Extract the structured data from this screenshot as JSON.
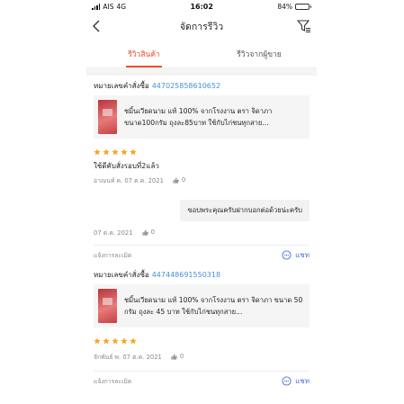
{
  "status": {
    "carrier": "AIS",
    "network": "4G",
    "time": "16:02",
    "battery": "84%",
    "battery_level": 0.84
  },
  "nav": {
    "title": "จัดการรีวิว"
  },
  "tabs": [
    {
      "label": "รีวิวสินค้า",
      "active": true
    },
    {
      "label": "รีวิวจากผู้ขาย",
      "active": false
    }
  ],
  "colors": {
    "accent": "#ee4d2d",
    "link": "#4a8fd6",
    "star": "#f5a623"
  },
  "reviews": [
    {
      "order_label": "หมายเลขคำสั่งซื้อ",
      "order_no": "447025858610652",
      "product": "ชมิ้นเวียดนาม แท้ 100% จากโรงงาน ตรา จิดาภา ขนาด100กรัม ถุงละ85บาท ใช้กับไก่ชนทุกสาย...",
      "rating": 5,
      "text": "ใช้ดีคับสั่งรอบที่2แล้ว",
      "date": "อาณนท์ ค. 07 ต.ค. 2021",
      "likes": "0",
      "reply": "ขอบพระคุณครับฝากบอกต่อด้วยน่ะครับ",
      "reply_date": "07 ต.ค. 2021",
      "reply_likes": "0",
      "report": "แจ้งการละเมิด",
      "chat": "แชท"
    },
    {
      "order_label": "หมายเลขคำสั่งซื้อ",
      "order_no": "447448691550318",
      "product": "ชมิ้นเวียดนาม แท้ 100% จากโรงงาน ตรา จิดาภา ขนาด 50 กรัม ถุงละ 45 บาท ใช้กับไก่ชนทุกสาย...",
      "rating": 5,
      "text": "",
      "date": "จักพันธ์ พ. 07 ต.ค. 2021",
      "likes": "0",
      "report": "แจ้งการละเมิด",
      "chat": "แชท"
    }
  ]
}
